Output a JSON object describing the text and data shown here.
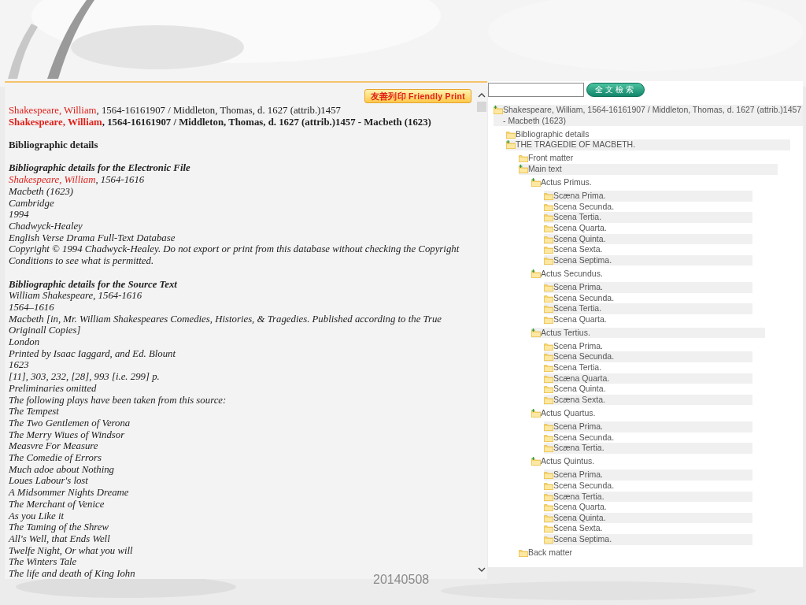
{
  "document_pane": {
    "print_button": "友善列印 Friendly Print",
    "header_line": {
      "author_link": "Shakespeare, William",
      "text": ", 1564-16161907 / Middleton, Thomas, d. 1627 (attrib.)1457"
    },
    "title_line": {
      "author_link": "Shakespeare, William",
      "text": ", 1564-16161907 / Middleton, Thomas, d. 1627 (attrib.)1457 - Macbeth (1623)"
    },
    "section_heading": "Bibliographic details",
    "electronic_file": {
      "heading": "Bibliographic details for the Electronic File",
      "author_link": "Shakespeare, William",
      "author_text": ", 1564-1616",
      "lines": [
        "Macbeth (1623)",
        "Cambridge",
        "1994",
        "Chadwyck-Healey",
        "English Verse Drama Full-Text Database",
        "Copyright © 1994 Chadwyck-Healey. Do not export or print from this database without checking the Copyright Conditions to see what is permitted."
      ]
    },
    "source_text": {
      "heading": "Bibliographic details for the Source Text",
      "lines": [
        "William Shakespeare, 1564-1616",
        "1564–1616",
        "Macbeth [in, Mr. William Shakespeares Comedies, Histories, & Tragedies. Published according to the True Originall Copies]",
        "London",
        "Printed by Isaac Iaggard, and Ed. Blount",
        "1623",
        "[11], 303, 232, [28], 993 [i.e. 299] p.",
        "Preliminaries omitted",
        "The following plays have been taken from this source:",
        "The Tempest",
        "The Two Gentlemen of Verona",
        "The Merry Wiues of Windsor",
        "Measvre For Measure",
        "The Comedie of Errors",
        "Much adoe about Nothing",
        "Loues Labour's lost",
        "A Midsommer Nights Dreame",
        "The Merchant of Venice",
        "As you Like it",
        "The Taming of the Shrew",
        "All's Well, that Ends Well",
        "Twelfe Night, Or what you will",
        "The Winters Tale",
        "The life and death of King Iohn"
      ]
    }
  },
  "toc_pane": {
    "search_button": "全文檢索",
    "tree": [
      {
        "label": "Shakespeare, William, 1564-16161907 / Middleton, Thomas, d. 1627 (attrib.)1457 - Macbeth (1623)",
        "children": [
          {
            "label": "Bibliographic details"
          },
          {
            "label": "THE TRAGEDIE OF MACBETH.",
            "children": [
              {
                "label": "Front matter"
              },
              {
                "label": "Main text",
                "children": [
                  {
                    "label": "Actus Primus.",
                    "children": [
                      {
                        "label": "Scæna Prima."
                      },
                      {
                        "label": "Scena Secunda."
                      },
                      {
                        "label": "Scena Tertia."
                      },
                      {
                        "label": "Scena Quarta."
                      },
                      {
                        "label": "Scena Quinta."
                      },
                      {
                        "label": "Scena Sexta."
                      },
                      {
                        "label": "Scena Septima."
                      }
                    ]
                  },
                  {
                    "label": "Actus Secundus.",
                    "children": [
                      {
                        "label": "Scena Prima."
                      },
                      {
                        "label": "Scena Secunda."
                      },
                      {
                        "label": "Scena Tertia."
                      },
                      {
                        "label": "Scena Quarta."
                      }
                    ]
                  },
                  {
                    "label": "Actus Tertius.",
                    "children": [
                      {
                        "label": "Scena Prima."
                      },
                      {
                        "label": "Scena Secunda."
                      },
                      {
                        "label": "Scena Tertia."
                      },
                      {
                        "label": "Scæna Quarta."
                      },
                      {
                        "label": "Scena Quinta."
                      },
                      {
                        "label": "Scæna Sexta."
                      }
                    ]
                  },
                  {
                    "label": "Actus Quartus.",
                    "children": [
                      {
                        "label": "Scena Prima."
                      },
                      {
                        "label": "Scena Secunda."
                      },
                      {
                        "label": "Scæna Tertia."
                      }
                    ]
                  },
                  {
                    "label": "Actus Quintus.",
                    "children": [
                      {
                        "label": "Scena Prima."
                      },
                      {
                        "label": "Scena Secunda."
                      },
                      {
                        "label": "Scæna Tertia."
                      },
                      {
                        "label": "Scena Quarta."
                      },
                      {
                        "label": "Scena Quinta."
                      },
                      {
                        "label": "Scena Sexta."
                      },
                      {
                        "label": "Scena Septima."
                      }
                    ]
                  }
                ]
              },
              {
                "label": "Back matter"
              }
            ]
          }
        ]
      }
    ]
  },
  "slide_date": "20140508"
}
